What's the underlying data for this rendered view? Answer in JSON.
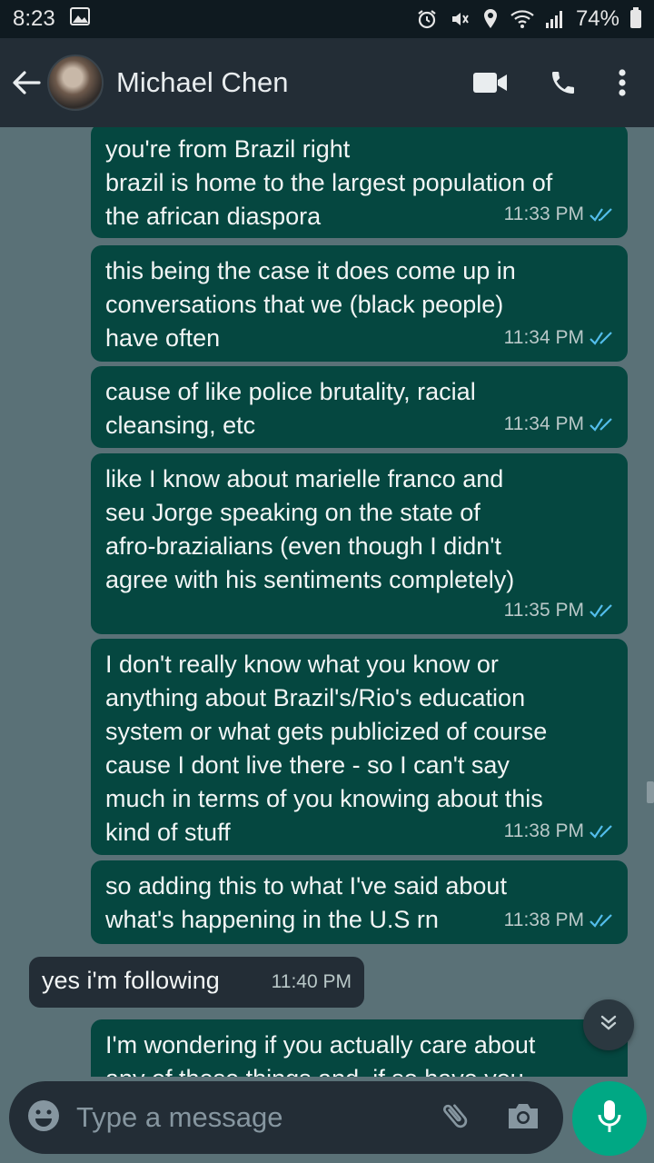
{
  "status_bar": {
    "time": "8:23",
    "battery": "74%"
  },
  "header": {
    "contact_name": "Michael Chen"
  },
  "messages": [
    {
      "direction": "out",
      "text": "you're from Brazil right\nbrazil is home to the largest population of\nthe african diaspora",
      "time": "11:33 PM"
    },
    {
      "direction": "out",
      "text": "this being the case it does come up in\nconversations that we (black people)\nhave often",
      "time": "11:34 PM"
    },
    {
      "direction": "out",
      "text": "cause of like police brutality, racial\ncleansing, etc",
      "time": "11:34 PM"
    },
    {
      "direction": "out",
      "text": "like I know about marielle franco and\nseu Jorge speaking on the state of\nafro-brazialians (even though I didn't\nagree with his sentiments completely)",
      "time": "11:35 PM"
    },
    {
      "direction": "out",
      "text": "I don't really know what you know or\nanything about Brazil's/Rio's education\nsystem or what gets publicized of course\ncause I dont live there -  so I can't say\nmuch in terms of you knowing about this\nkind of stuff",
      "time": "11:38 PM"
    },
    {
      "direction": "out",
      "text": "so adding this to what I've said about\nwhat's happening in the U.S rn",
      "time": "11:38 PM"
    },
    {
      "direction": "in",
      "text": "yes i'm following",
      "time": "11:40 PM"
    },
    {
      "direction": "out",
      "text": "I'm wondering if you actually care about\nany of these things and, if so have you",
      "time": ""
    }
  ],
  "composer": {
    "placeholder": "Type a message"
  },
  "colors": {
    "outgoing_bubble": "#054740",
    "incoming_bubble": "#232d36",
    "accent": "#00a884",
    "read_tick": "#53bdeb"
  }
}
